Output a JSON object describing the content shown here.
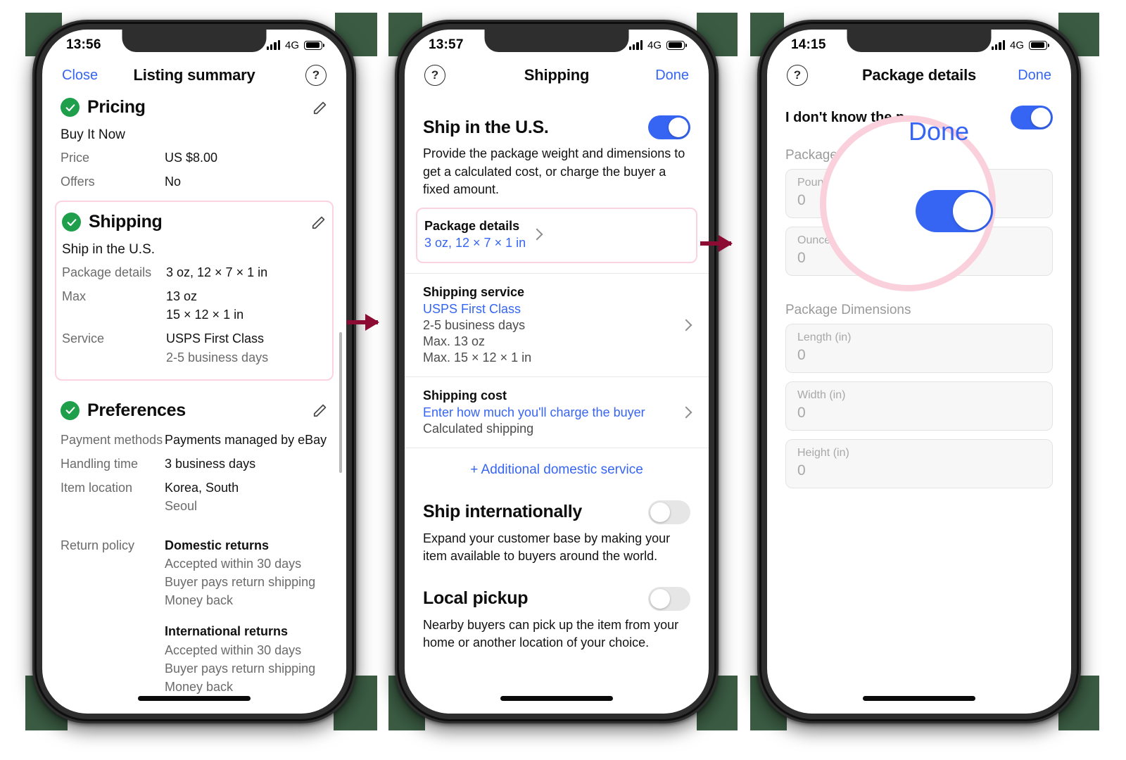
{
  "background_color": "#3b5c43",
  "accent_blue": "#3665f3",
  "highlight_pink": "#fbd3df",
  "arrow_color": "#8c0b33",
  "check_green": "#1f9e4b",
  "phone1": {
    "status": {
      "time": "13:56",
      "network": "4G"
    },
    "nav": {
      "left": "Close",
      "title": "Listing summary",
      "help": "?"
    },
    "pricing": {
      "title": "Pricing",
      "format": "Buy It Now",
      "rows": [
        {
          "label": "Price",
          "value": "US $8.00"
        },
        {
          "label": "Offers",
          "value": "No"
        }
      ]
    },
    "shipping": {
      "title": "Shipping",
      "region": "Ship in the U.S.",
      "rows": [
        {
          "label": "Package details",
          "value": "3 oz, 12 × 7 × 1 in",
          "sub": ""
        },
        {
          "label": "Max",
          "value": "13 oz",
          "value2": "15 × 12 × 1 in"
        },
        {
          "label": "Service",
          "value": "USPS First Class",
          "sub": "2-5 business days"
        }
      ]
    },
    "preferences": {
      "title": "Preferences",
      "rows": [
        {
          "label": "Payment methods",
          "value": "Payments managed by eBay"
        },
        {
          "label": "Handling time",
          "value": "3 business days"
        },
        {
          "label": "Item location",
          "value": "Korea, South",
          "sub": "Seoul"
        }
      ],
      "return_policy_label": "Return policy",
      "domestic_title": "Domestic returns",
      "domestic_lines": [
        "Accepted within 30 days",
        "Buyer pays return shipping",
        "Money back"
      ],
      "international_title": "International returns",
      "international_lines": [
        "Accepted within 30 days",
        "Buyer pays return shipping",
        "Money back"
      ]
    }
  },
  "phone2": {
    "status": {
      "time": "13:57",
      "network": "4G"
    },
    "nav": {
      "help": "?",
      "title": "Shipping",
      "right": "Done"
    },
    "ship_us": {
      "title": "Ship in the U.S.",
      "toggle": "on",
      "description": "Provide the package weight and dimensions to get a calculated cost, or charge the buyer a fixed amount."
    },
    "package_details": {
      "title": "Package details",
      "value": "3 oz, 12 × 7 × 1 in"
    },
    "shipping_service": {
      "title": "Shipping service",
      "link": "USPS First Class",
      "lines": [
        "2-5 business days",
        "Max. 13 oz",
        "Max. 15 × 12 × 1 in"
      ]
    },
    "shipping_cost": {
      "title": "Shipping cost",
      "link": "Enter how much you'll charge the buyer",
      "sub": "Calculated shipping"
    },
    "additional_service": "+ Additional domestic service",
    "ship_intl": {
      "title": "Ship internationally",
      "toggle": "off",
      "description": "Expand your customer base by making your item available to buyers around the world."
    },
    "local_pickup": {
      "title": "Local pickup",
      "toggle": "off",
      "description": "Nearby buyers can pick up the item from your home or another location of your choice."
    }
  },
  "phone3": {
    "status": {
      "time": "14:15",
      "network": "4G"
    },
    "nav": {
      "help": "?",
      "title": "Package details",
      "right": "Done"
    },
    "dont_know": {
      "label": "I don't know the p",
      "toggle": "on"
    },
    "weight_group": "Package Weigh",
    "weight_fields": [
      {
        "label": "Pounds (lb)",
        "value": "0"
      },
      {
        "label": "Ounces (oz)",
        "value": "0"
      }
    ],
    "dimensions_group": "Package Dimensions",
    "dimension_fields": [
      {
        "label": "Length (in)",
        "value": "0"
      },
      {
        "label": "Width (in)",
        "value": "0"
      },
      {
        "label": "Height (in)",
        "value": "0"
      }
    ],
    "magnifier": {
      "done_label": "Done",
      "toggle": "on"
    }
  }
}
